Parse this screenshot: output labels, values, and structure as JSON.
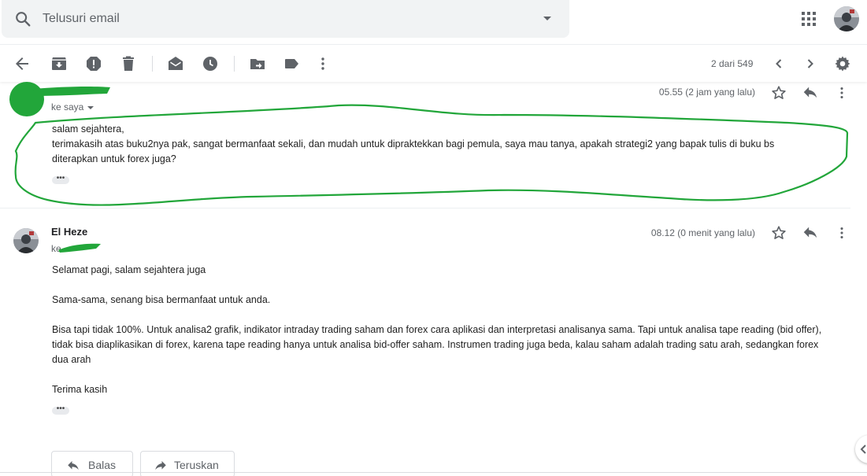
{
  "search": {
    "placeholder": "Telusuri email"
  },
  "toolbar": {
    "pager": "2 dari 549"
  },
  "message1": {
    "to": "ke saya",
    "date": "05.55 (2 jam yang lalu)",
    "lines": [
      "salam sejahtera,",
      "terimakasih atas buku2nya pak, sangat bermanfaat sekali, dan mudah untuk dipraktekkan bagi pemula, saya mau tanya, apakah strategi2 yang bapak tulis di buku bs",
      "diterapkan untuk forex juga?"
    ],
    "expand": "•••"
  },
  "message2": {
    "sender": "El Heze",
    "to": "ke",
    "date": "08.12 (0 menit yang lalu)",
    "paragraphs": [
      "Selamat pagi, salam sejahtera juga",
      "Sama-sama, senang bisa bermanfaat untuk anda.",
      "Bisa tapi tidak 100%. Untuk analisa2 grafik, indikator intraday trading saham dan forex cara aplikasi dan interpretasi analisanya sama. Tapi untuk analisa tape reading (bid offer), tidak bisa diaplikasikan di forex, karena tape reading hanya untuk analisa bid-offer saham. Instrumen trading juga beda, kalau saham adalah trading satu arah, sedangkan forex dua arah",
      "Terima kasih"
    ],
    "expand": "•••"
  },
  "actions": {
    "reply": "Balas",
    "forward": "Teruskan"
  },
  "colors": {
    "annotation_green": "#22a63a",
    "icon_gray": "#5f6368"
  }
}
